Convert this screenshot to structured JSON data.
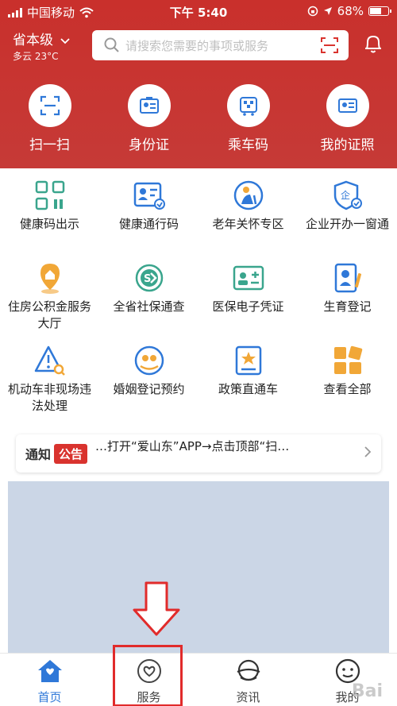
{
  "status": {
    "carrier": "中国移动",
    "time": "下午 5:40",
    "battery": "68%",
    "battery_level": 0.68
  },
  "header": {
    "region": "省本级",
    "weather": "多云 23°C",
    "search_placeholder": "请搜索您需要的事项或服务"
  },
  "quick_actions": [
    {
      "label": "扫一扫",
      "icon": "scan-icon"
    },
    {
      "label": "身份证",
      "icon": "id-card-icon"
    },
    {
      "label": "乘车码",
      "icon": "bus-code-icon"
    },
    {
      "label": "我的证照",
      "icon": "license-icon"
    }
  ],
  "services": [
    {
      "label": "健康码出示",
      "icon": "qr-code-icon"
    },
    {
      "label": "健康通行码",
      "icon": "health-pass-icon"
    },
    {
      "label": "老年关怀专区",
      "icon": "elderly-care-icon"
    },
    {
      "label": "企业开办一窗通",
      "icon": "enterprise-icon"
    },
    {
      "label": "住房公积金服务大厅",
      "icon": "housing-fund-icon"
    },
    {
      "label": "全省社保通查",
      "icon": "social-security-icon"
    },
    {
      "label": "医保电子凭证",
      "icon": "medical-insurance-icon"
    },
    {
      "label": "生育登记",
      "icon": "birth-registration-icon"
    },
    {
      "label": "机动车非现场违法处理",
      "icon": "traffic-violation-icon"
    },
    {
      "label": "婚姻登记预约",
      "icon": "marriage-icon"
    },
    {
      "label": "政策直通车",
      "icon": "policy-icon"
    },
    {
      "label": "查看全部",
      "icon": "all-services-icon"
    }
  ],
  "notice": {
    "title": "通知",
    "badge": "公告",
    "text": "…打开“爱山东”APP→点击顶部“扫…"
  },
  "tabs": [
    {
      "label": "首页",
      "icon": "home-icon",
      "active": true
    },
    {
      "label": "服务",
      "icon": "heart-icon",
      "active": false
    },
    {
      "label": "资讯",
      "icon": "news-icon",
      "active": false
    },
    {
      "label": "我的",
      "icon": "profile-icon",
      "active": false
    }
  ],
  "watermark": "Bai"
}
